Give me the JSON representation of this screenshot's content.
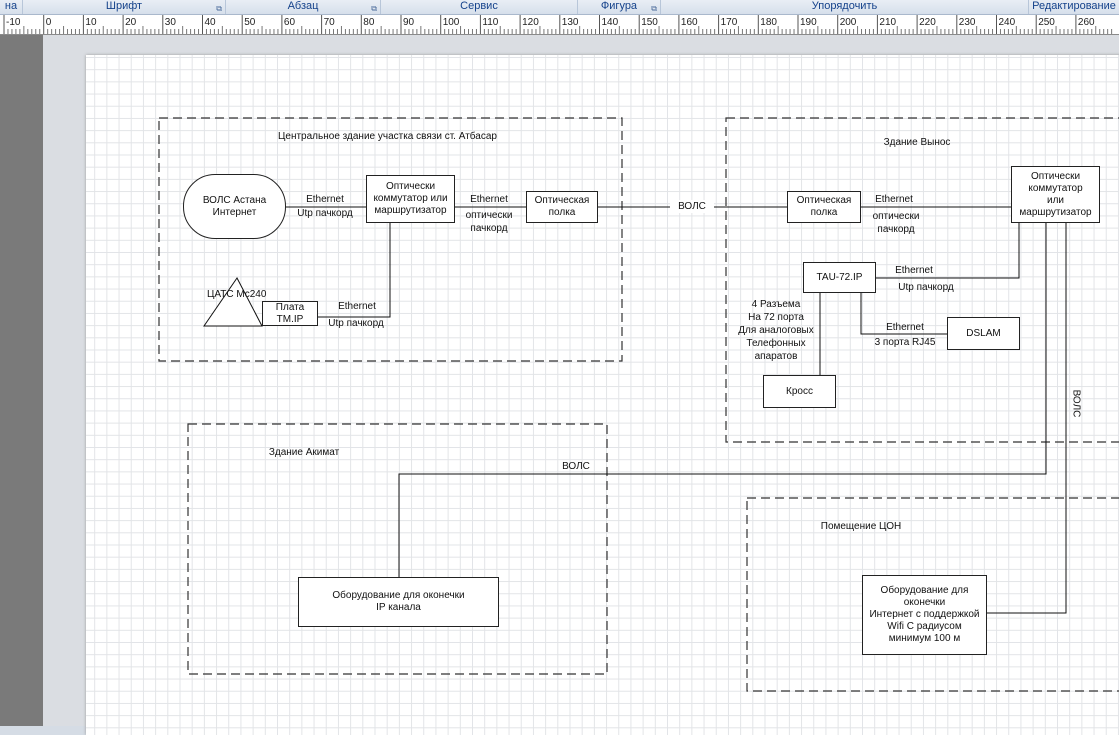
{
  "ribbon": {
    "groups": [
      "на",
      "Шрифт",
      "Абзац",
      "Сервис",
      "Фигура",
      "Упорядочить",
      "Редактирование"
    ]
  },
  "ruler": {
    "labels": [
      "-10",
      "0",
      "10",
      "20",
      "30",
      "40",
      "50",
      "60",
      "70",
      "80",
      "90",
      "100",
      "110",
      "120",
      "130",
      "140",
      "150",
      "160",
      "170",
      "180",
      "190",
      "200",
      "210",
      "220",
      "230",
      "240",
      "250",
      "260"
    ]
  },
  "zones": {
    "central": "Центральное здание\nучастка связи ст. Атбасар",
    "remote": "Здание Вынос",
    "akimat": "Здание Акимат",
    "tson": "Помещение ЦОН"
  },
  "nodes": {
    "vols_astana": "ВОЛС Астана\nИнтернет",
    "opt_switch_central": "Оптически\nкоммутатор или\nмаршрутизатор",
    "opt_shelf_central": "Оптическая\nполка",
    "catc": "ЦАТС\nMc240",
    "plata": "Плата\nTM.IP",
    "opt_shelf_remote": "Оптическая\nполка",
    "opt_switch_remote": "Оптически\nкоммутатор\nили\nмаршрутизатор",
    "tau": "TAU-72.IP",
    "dslam": "DSLAM",
    "kross": "Кросс",
    "akimat_equipment": "Оборудование для оконечки\nIP канала",
    "tson_equipment": "Оборудование для\nоконечки\nИнтернет с поддержкой\nWifi С радиусом\nминимум 100 м"
  },
  "edges": {
    "eth1_top": "Ethernet",
    "eth1_bottom": "Utp пачкорд",
    "eth2_top": "Ethernet",
    "eth2_bottom": "оптически\nпачкорд",
    "vols_main": "ВОЛС",
    "eth3_top": "Ethernet",
    "eth3_bottom": "Utp пачкорд",
    "eth4_top": "Ethernet",
    "eth4_bottom": "оптически\nпачкорд",
    "eth5_top": "Ethernet",
    "eth5_bottom": "Utp пачкорд",
    "eth6_top": "Ethernet",
    "eth6_bottom": "3 порта RJ45",
    "kross_note": "4 Разъема\nНа 72 порта\nДля аналоговых\nТелефонных\nапаратов",
    "vols_vertical": "ВОЛС",
    "vols_akimat": "ВОЛС"
  }
}
